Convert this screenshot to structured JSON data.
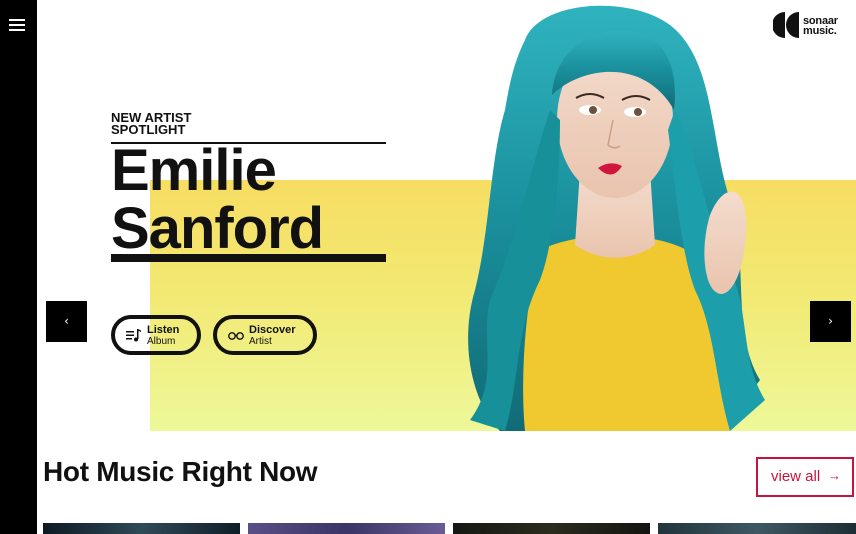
{
  "nav": {
    "menu_icon": "hamburger-menu-icon"
  },
  "brand": {
    "logo_line1": "sonaar",
    "logo_line2": "music."
  },
  "hero": {
    "kicker_line1": "NEW ARTIST",
    "kicker_line2": "SPOTLIGHT",
    "name_line1": "Emilie",
    "name_line2": "Sanford",
    "buttons": [
      {
        "label": "Listen",
        "sublabel": "Album",
        "icon": "music-list-icon"
      },
      {
        "label": "Discover",
        "sublabel": "Artist",
        "icon": "glasses-icon"
      }
    ],
    "prev_glyph": "‹",
    "next_glyph": "›"
  },
  "section": {
    "title": "Hot Music Right Now",
    "view_all_label": "view all",
    "view_all_arrow": "→"
  },
  "colors": {
    "accent": "#c8143c",
    "panel_yellow_top": "#f7dd62",
    "panel_yellow_bottom": "#eef89a",
    "hair": "#1b9aa8",
    "sidebar": "#000000"
  }
}
